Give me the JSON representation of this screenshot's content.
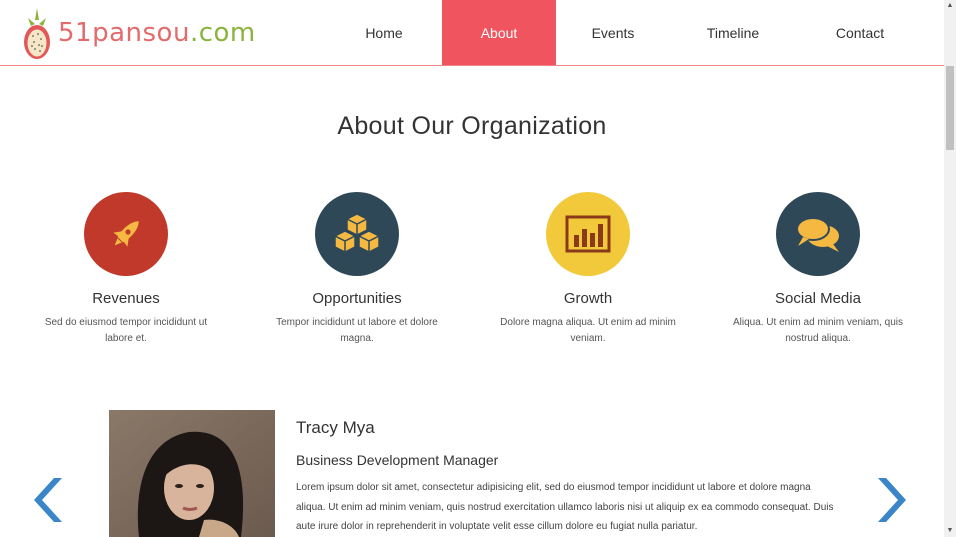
{
  "header": {
    "logo_text_main": "51pansou",
    "logo_text_domain": ".com",
    "nav": [
      {
        "label": "Home",
        "active": false
      },
      {
        "label": "About",
        "active": true
      },
      {
        "label": "Events",
        "active": false
      },
      {
        "label": "Timeline",
        "active": false
      },
      {
        "label": "Contact",
        "active": false
      }
    ]
  },
  "about": {
    "title": "About Our Organization",
    "features": [
      {
        "icon": "rocket-icon",
        "color": "#c0392b",
        "title": "Revenues",
        "text": "Sed do eiusmod tempor incididunt ut labore et."
      },
      {
        "icon": "cubes-icon",
        "color": "#2f4858",
        "title": "Opportunities",
        "text": "Tempor incididunt ut labore et dolore magna."
      },
      {
        "icon": "bar-chart-icon",
        "color": "#f1c93b",
        "title": "Growth",
        "text": "Dolore magna aliqua. Ut enim ad minim veniam."
      },
      {
        "icon": "chat-bubbles-icon",
        "color": "#2f4858",
        "title": "Social Media",
        "text": "Aliqua. Ut enim ad minim veniam, quis nostrud aliqua."
      }
    ]
  },
  "testimonial": {
    "name": "Tracy Mya",
    "role": "Business Development Manager",
    "body": "Lorem ipsum dolor sit amet, consectetur adipisicing elit, sed do eiusmod tempor incididunt ut labore et dolore magna aliqua. Ut enim ad minim veniam, quis nostrud exercitation ullamco laboris nisi ut aliquip ex ea commodo consequat. Duis aute irure dolor in reprehenderit in voluptate velit esse cillum dolore eu fugiat nulla pariatur."
  },
  "colors": {
    "accent": "#f0555f",
    "logo_red": "#e36b6b",
    "logo_green": "#8bb43d",
    "arrow_blue": "#3a86c8"
  }
}
